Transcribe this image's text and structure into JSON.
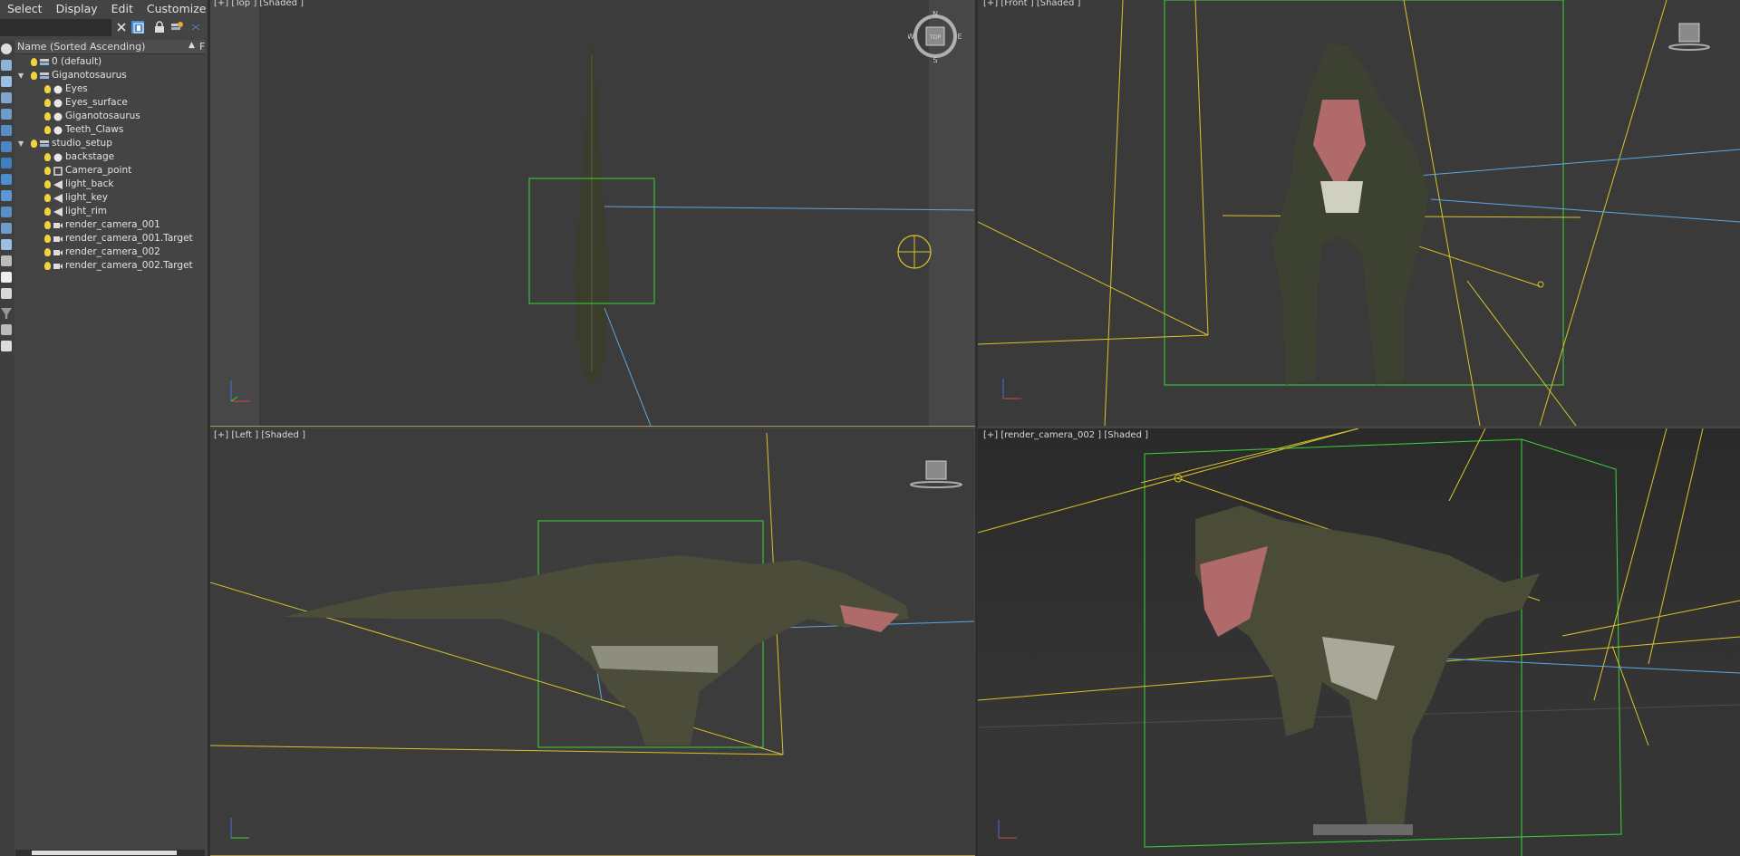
{
  "menu": {
    "items": [
      "Select",
      "Display",
      "Edit",
      "Customize"
    ]
  },
  "search": {
    "value": "",
    "placeholder": ""
  },
  "list_header": {
    "column": "Name (Sorted Ascending)",
    "sort_arrow": "▲",
    "next_column": "F"
  },
  "tree": [
    {
      "label": "0 (default)",
      "depth": 0,
      "kind": "layer",
      "expandable": false
    },
    {
      "label": "Giganotosaurus",
      "depth": 0,
      "kind": "layer",
      "expandable": true
    },
    {
      "label": "Eyes",
      "depth": 1,
      "kind": "geometry",
      "expandable": false
    },
    {
      "label": "Eyes_surface",
      "depth": 1,
      "kind": "geometry",
      "expandable": false
    },
    {
      "label": "Giganotosaurus",
      "depth": 1,
      "kind": "geometry",
      "expandable": false
    },
    {
      "label": "Teeth_Claws",
      "depth": 1,
      "kind": "geometry",
      "expandable": false
    },
    {
      "label": "studio_setup",
      "depth": 0,
      "kind": "layer",
      "expandable": true
    },
    {
      "label": "backstage",
      "depth": 1,
      "kind": "geometry",
      "expandable": false
    },
    {
      "label": "Camera_point",
      "depth": 1,
      "kind": "helper",
      "expandable": false
    },
    {
      "label": "light_back",
      "depth": 1,
      "kind": "light",
      "expandable": false
    },
    {
      "label": "light_key",
      "depth": 1,
      "kind": "light",
      "expandable": false
    },
    {
      "label": "light_rim",
      "depth": 1,
      "kind": "light",
      "expandable": false
    },
    {
      "label": "render_camera_001",
      "depth": 1,
      "kind": "camera",
      "expandable": false
    },
    {
      "label": "render_camera_001.Target",
      "depth": 1,
      "kind": "camera",
      "expandable": false
    },
    {
      "label": "render_camera_002",
      "depth": 1,
      "kind": "camera",
      "expandable": false
    },
    {
      "label": "render_camera_002.Target",
      "depth": 1,
      "kind": "camera",
      "expandable": false
    }
  ],
  "viewports": {
    "top": {
      "label": "[+] [Top ] [Shaded ]"
    },
    "front": {
      "label": "[+] [Front ] [Shaded ]"
    },
    "left": {
      "label": "[+] [Left ] [Shaded ]"
    },
    "camera": {
      "label": "[+] [render_camera_002 ] [Shaded ]"
    }
  },
  "compass": {
    "n": "N",
    "s": "S",
    "e": "E",
    "w": "W",
    "cube": "TOP"
  },
  "colors": {
    "viewport_bg": "#3c3c3c",
    "selection_box": "#3ad43a",
    "light_lines": "#d9c42a",
    "camera_lines": "#5aa8e0",
    "active_border": "#a89554",
    "bulb": "#f2d33a"
  }
}
